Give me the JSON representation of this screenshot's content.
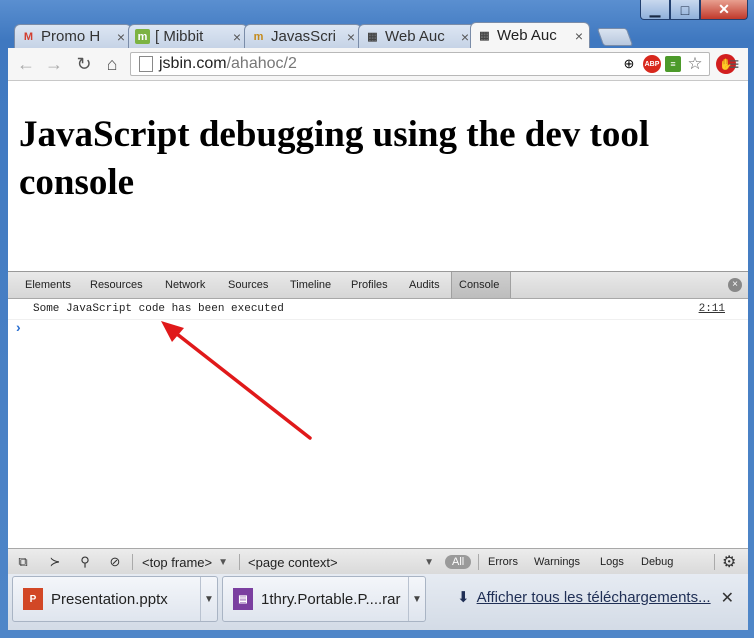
{
  "window": {
    "minimize_glyph": "▁",
    "maximize_glyph": "□",
    "close_glyph": "✕"
  },
  "tabs": [
    {
      "label": "Promo H",
      "favicon": "gmail-icon",
      "fav_glyph": "M",
      "fav_color": "#d23f31",
      "active": false
    },
    {
      "label": "[ Mibbit",
      "favicon": "mibbit-icon",
      "fav_glyph": "m",
      "fav_color": "#7cb342",
      "active": false
    },
    {
      "label": "JavasScri",
      "favicon": "mdn-icon",
      "fav_glyph": "m",
      "fav_color": "#c48a1a",
      "active": false
    },
    {
      "label": "Web Auc",
      "favicon": "film-icon",
      "fav_glyph": "▦",
      "fav_color": "#444444",
      "active": false
    },
    {
      "label": "Web Auc",
      "favicon": "film-icon",
      "fav_glyph": "▦",
      "fav_color": "#444444",
      "active": true
    }
  ],
  "tab_close_glyph": "×",
  "toolbar": {
    "back_glyph": "←",
    "forward_glyph": "→",
    "reload_glyph": "↻",
    "home_glyph": "⌂",
    "url_host": "jsbin.com",
    "url_path": "/ahahoc/2",
    "zoom_glyph": "⊕",
    "abp_label": "ABP",
    "rss_label": "≡",
    "star_glyph": "☆",
    "stop_glyph": "✋",
    "menu_glyph": "≡"
  },
  "page": {
    "heading": "JavaScript debugging using the dev tool console"
  },
  "devtools": {
    "tabs": [
      "Elements",
      "Resources",
      "Network",
      "Sources",
      "Timeline",
      "Profiles",
      "Audits",
      "Console"
    ],
    "active_tab": "Console",
    "close_glyph": "×",
    "console": {
      "messages": [
        {
          "text": "Some JavaScript code has been executed",
          "source": "2:11"
        }
      ],
      "prompt": "›"
    },
    "statusbar": {
      "dock_glyph": "⧉",
      "drawer_glyph": "≻",
      "search_glyph": "⚲",
      "clear_glyph": "⊘",
      "frame_select": "<top frame>",
      "context_select": "<page context>",
      "caret_glyph": "▼",
      "filter_all": "All",
      "filters": [
        "Errors",
        "Warnings",
        "Logs",
        "Debug"
      ],
      "gear_glyph": "⚙"
    }
  },
  "downloads": {
    "items": [
      {
        "name": "Presentation.pptx",
        "icon": "powerpoint-file-icon",
        "icon_color": "#d24726",
        "icon_glyph": "P"
      },
      {
        "name": "1thry.Portable.P....rar",
        "icon": "winrar-archive-icon",
        "icon_color": "#7b3fa0",
        "icon_glyph": "▤"
      }
    ],
    "caret_glyph": "▼",
    "show_all_glyph": "⬇",
    "show_all_label": "Afficher tous les téléchargements...",
    "close_glyph": "✕"
  },
  "colors": {
    "annotation_arrow": "#e0191a",
    "window_frame": "#3f78c0"
  }
}
